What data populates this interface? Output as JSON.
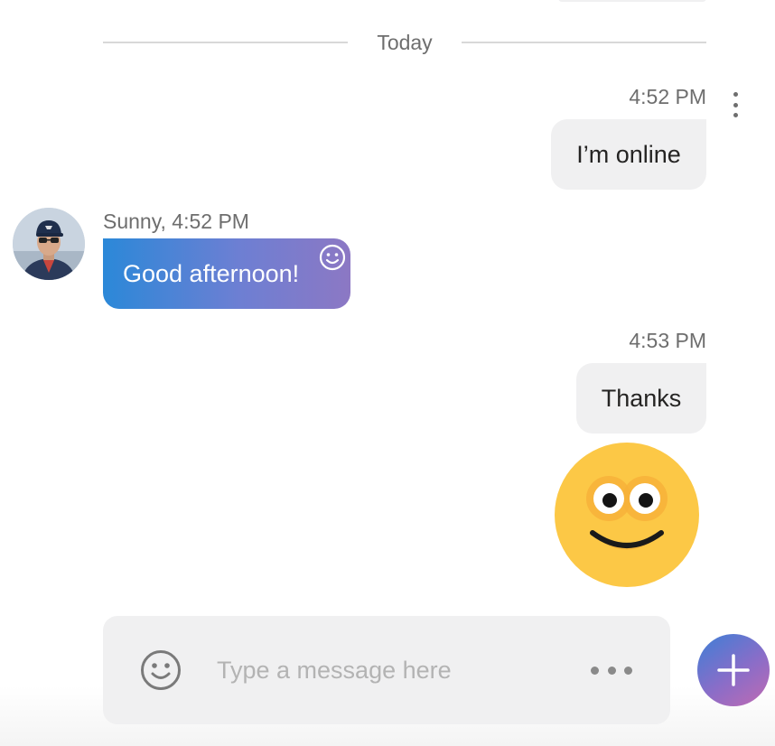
{
  "divider": {
    "label": "Today"
  },
  "messages": [
    {
      "direction": "outgoing",
      "timestamp": "4:52 PM",
      "text": "I’m online"
    },
    {
      "direction": "incoming",
      "sender_meta": "Sunny, 4:52 PM",
      "text": "Good afternoon!"
    },
    {
      "direction": "outgoing",
      "timestamp": "4:53 PM",
      "text": "Thanks"
    },
    {
      "direction": "outgoing",
      "sticker": "smiley-emoji-icon"
    }
  ],
  "compose": {
    "placeholder": "Type a message here",
    "value": ""
  },
  "icons": {
    "message_menu": "more-vertical-icon",
    "reaction": "smiley-outline-icon",
    "compose_emoji": "smiley-outline-icon",
    "compose_more": "more-horizontal-icon",
    "fab": "plus-icon"
  },
  "colors": {
    "incoming_bubble_start": "#2b88d8",
    "incoming_bubble_end": "#8c78c4",
    "outgoing_bubble": "#f0f0f1",
    "fab_start": "#3d7fd6",
    "fab_end": "#c06ab2",
    "emoji_yellow": "#fcc846"
  }
}
